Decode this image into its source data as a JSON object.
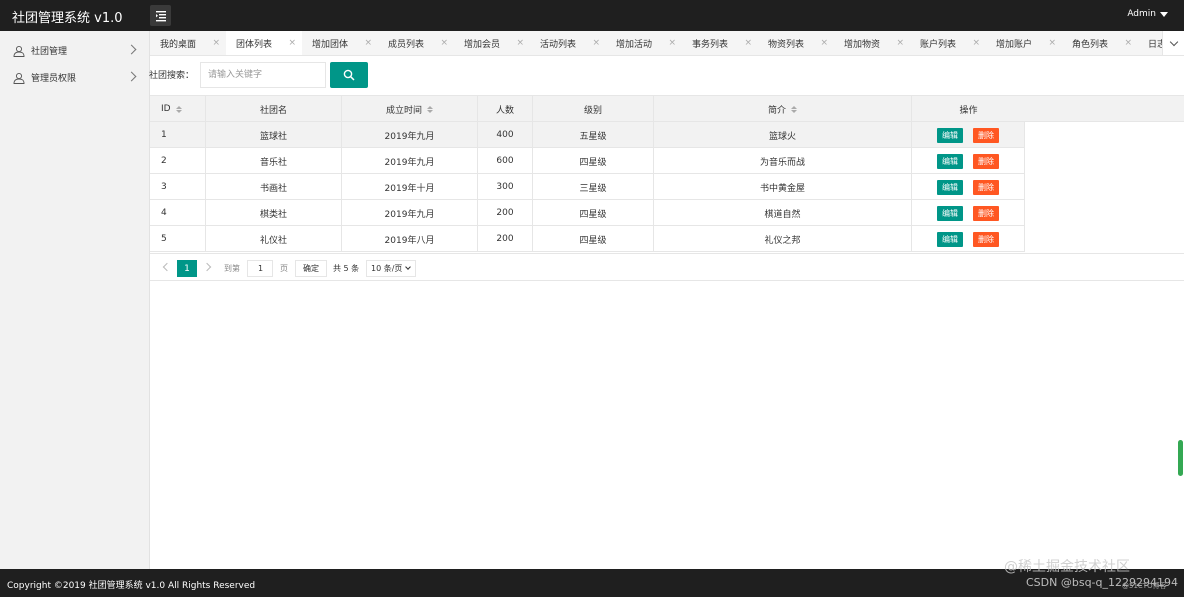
{
  "header": {
    "app_title": "社团管理系统 v1.0",
    "user": "Admin"
  },
  "sidebar": {
    "items": [
      {
        "label": "社团管理",
        "icon": "user-icon"
      },
      {
        "label": "管理员权限",
        "icon": "user-icon"
      }
    ]
  },
  "tabs": [
    {
      "label": "我的桌面",
      "active": false
    },
    {
      "label": "团体列表",
      "active": true
    },
    {
      "label": "增加团体",
      "active": false
    },
    {
      "label": "成员列表",
      "active": false
    },
    {
      "label": "增加会员",
      "active": false
    },
    {
      "label": "活动列表",
      "active": false
    },
    {
      "label": "增加活动",
      "active": false
    },
    {
      "label": "事务列表",
      "active": false
    },
    {
      "label": "物资列表",
      "active": false
    },
    {
      "label": "增加物资",
      "active": false
    },
    {
      "label": "账户列表",
      "active": false
    },
    {
      "label": "增加账户",
      "active": false
    },
    {
      "label": "角色列表",
      "active": false
    },
    {
      "label": "日志",
      "active": false
    }
  ],
  "tab_close_glyph": "×",
  "search": {
    "label": "社团搜索：",
    "placeholder": "请输入关键字",
    "value": ""
  },
  "table": {
    "columns": [
      "ID",
      "社团名",
      "成立时间",
      "人数",
      "级别",
      "简介",
      "操作"
    ],
    "rows": [
      {
        "id": "1",
        "name": "篮球社",
        "date": "2019年九月",
        "count": "400",
        "level": "五星级",
        "intro": "篮球火"
      },
      {
        "id": "2",
        "name": "音乐社",
        "date": "2019年九月",
        "count": "600",
        "level": "四星级",
        "intro": "为音乐而战"
      },
      {
        "id": "3",
        "name": "书画社",
        "date": "2019年十月",
        "count": "300",
        "level": "三星级",
        "intro": "书中黄金屋"
      },
      {
        "id": "4",
        "name": "棋类社",
        "date": "2019年九月",
        "count": "200",
        "level": "四星级",
        "intro": "棋道自然"
      },
      {
        "id": "5",
        "name": "礼仪社",
        "date": "2019年八月",
        "count": "200",
        "level": "四星级",
        "intro": "礼仪之邦"
      }
    ],
    "edit_label": "编辑",
    "delete_label": "删除"
  },
  "pager": {
    "current": "1",
    "goto_label": "到第",
    "goto_value": "1",
    "page_unit": "页",
    "confirm": "确定",
    "total": "共 5 条",
    "page_size": "10 条/页"
  },
  "footer": {
    "copyright": "Copyright ©2019 社团管理系统 v1.0 All Rights Reserved"
  },
  "watermarks": {
    "w1": "@稀土掘金技术社区",
    "w2": "CSDN @bsq-q_1229294194",
    "w3": "@51CTO博客"
  },
  "colors": {
    "accent": "#009688",
    "danger": "#ff5722",
    "header_bg": "#1f1f1f"
  }
}
